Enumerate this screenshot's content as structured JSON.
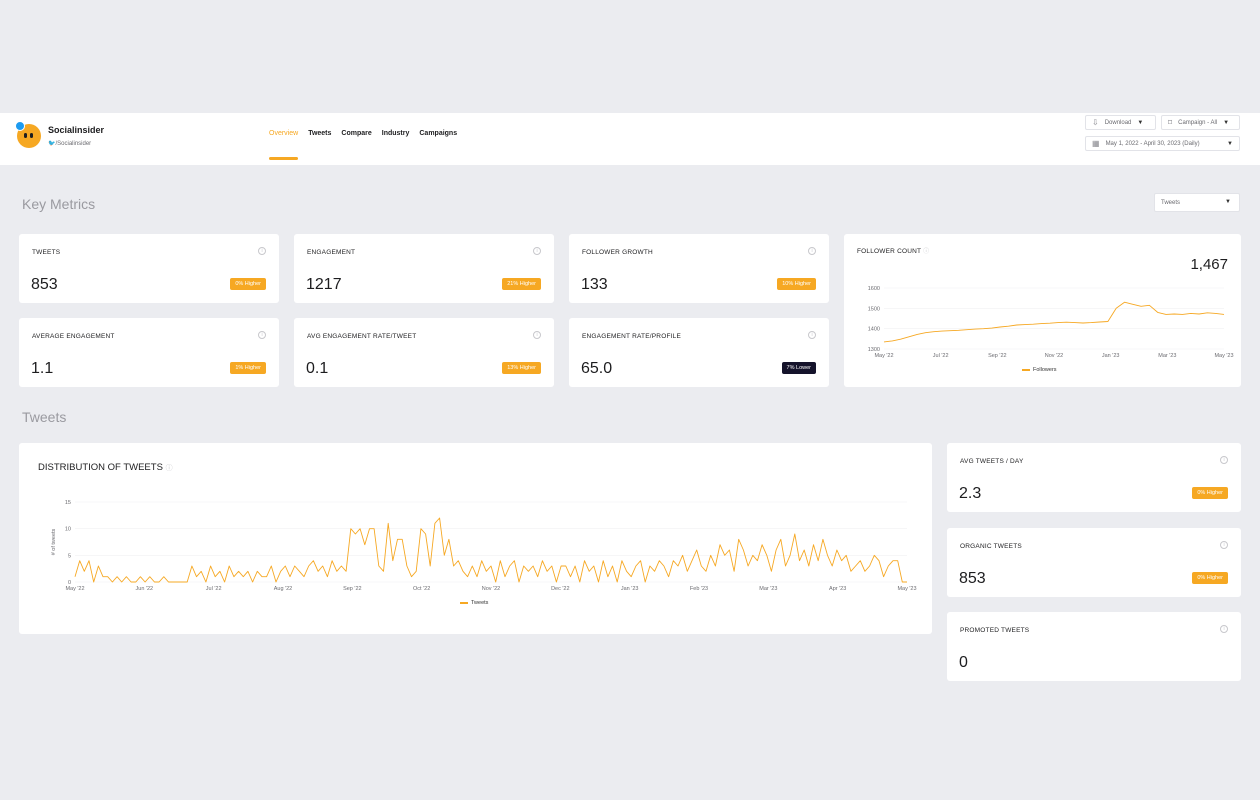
{
  "header": {
    "brand_name": "Socialinsider",
    "brand_handle": "/Socialinsider",
    "nav": [
      "Overview",
      "Tweets",
      "Compare",
      "Industry",
      "Campaigns"
    ],
    "active_nav": "Overview",
    "download_label": "Download",
    "campaign_label": "Campaign - All",
    "date_range": "May 1, 2022 - April 30, 2023 (Daily)"
  },
  "key_metrics": {
    "title": "Key Metrics",
    "select_value": "Tweets",
    "cards": [
      {
        "label": "TWEETS",
        "value": "853",
        "badge": "0% Higher"
      },
      {
        "label": "ENGAGEMENT",
        "value": "1217",
        "badge": "21% Higher"
      },
      {
        "label": "FOLLOWER GROWTH",
        "value": "133",
        "badge": "10% Higher"
      },
      {
        "label": "AVERAGE ENGAGEMENT",
        "value": "1.1",
        "badge": "1% Higher"
      },
      {
        "label": "AVG ENGAGEMENT RATE/TWEET",
        "value": "0.1",
        "badge": "13% Higher"
      },
      {
        "label": "ENGAGEMENT RATE/PROFILE",
        "value": "65.0",
        "badge": "7% Lower"
      }
    ],
    "follower_count": {
      "label": "FOLLOWER COUNT",
      "value": "1,467"
    }
  },
  "tweets_section": {
    "title": "Tweets",
    "distribution_title": "DISTRIBUTION OF TWEETS",
    "side_cards": [
      {
        "label": "AVG TWEETS / DAY",
        "value": "2.3",
        "badge": "0% Higher"
      },
      {
        "label": "ORGANIC TWEETS",
        "value": "853",
        "badge": "0% Higher"
      },
      {
        "label": "PROMOTED TWEETS",
        "value": "0",
        "badge": ""
      }
    ]
  },
  "colors": {
    "accent": "#f6a823",
    "dark_badge": "#15132b"
  },
  "chart_data": [
    {
      "type": "line",
      "title": "FOLLOWER COUNT",
      "series": [
        {
          "name": "Followers",
          "values": [
            1335,
            1340,
            1348,
            1360,
            1372,
            1380,
            1385,
            1388,
            1390,
            1392,
            1395,
            1398,
            1400,
            1403,
            1408,
            1412,
            1418,
            1420,
            1422,
            1425,
            1427,
            1430,
            1432,
            1430,
            1428,
            1430,
            1433,
            1435,
            1500,
            1530,
            1520,
            1510,
            1515,
            1480,
            1470,
            1472,
            1470,
            1475,
            1472,
            1478,
            1475,
            1470
          ]
        }
      ],
      "x_ticks": [
        "May '22",
        "Jul '22",
        "Sep '22",
        "Nov '22",
        "Jan '23",
        "Mar '23",
        "May '23"
      ],
      "y_ticks": [
        1300,
        1400,
        1500,
        1600
      ],
      "ylim": [
        1300,
        1600
      ]
    },
    {
      "type": "line",
      "title": "DISTRIBUTION OF TWEETS",
      "ylabel": "# of tweets",
      "series": [
        {
          "name": "Tweets",
          "values": [
            1,
            4,
            2,
            4,
            0,
            3,
            1,
            1,
            0,
            1,
            0,
            1,
            0,
            0,
            1,
            0,
            1,
            0,
            0,
            1,
            0,
            0,
            0,
            0,
            0,
            3,
            1,
            2,
            0,
            3,
            1,
            2,
            0,
            3,
            1,
            2,
            1,
            2,
            0,
            2,
            1,
            1,
            3,
            0,
            2,
            3,
            1,
            3,
            2,
            1,
            3,
            4,
            2,
            3,
            1,
            4,
            2,
            3,
            2,
            10,
            9,
            10,
            7,
            10,
            10,
            3,
            2,
            11,
            4,
            8,
            8,
            3,
            1,
            2,
            10,
            9,
            3,
            11,
            12,
            5,
            8,
            3,
            4,
            2,
            1,
            3,
            1,
            4,
            2,
            3,
            0,
            4,
            1,
            3,
            4,
            0,
            3,
            2,
            3,
            1,
            4,
            2,
            3,
            0,
            3,
            3,
            1,
            3,
            0,
            4,
            2,
            3,
            0,
            4,
            1,
            3,
            0,
            4,
            2,
            1,
            3,
            4,
            0,
            3,
            2,
            4,
            3,
            1,
            4,
            3,
            5,
            2,
            4,
            6,
            3,
            2,
            5,
            3,
            7,
            5,
            6,
            2,
            8,
            6,
            3,
            5,
            4,
            7,
            5,
            2,
            6,
            8,
            3,
            5,
            9,
            4,
            6,
            3,
            7,
            4,
            8,
            5,
            3,
            6,
            4,
            5,
            2,
            3,
            4,
            2,
            3,
            5,
            4,
            1,
            3,
            4,
            4,
            0,
            0
          ]
        }
      ],
      "x_ticks": [
        "May '22",
        "Jun '22",
        "Jul '22",
        "Aug '22",
        "Sep '22",
        "Oct '22",
        "Nov '22",
        "Dec '22",
        "Jan '23",
        "Feb '23",
        "Mar '23",
        "Apr '23",
        "May '23"
      ],
      "y_ticks": [
        0,
        5,
        10,
        15
      ],
      "ylim": [
        0,
        15
      ]
    }
  ]
}
